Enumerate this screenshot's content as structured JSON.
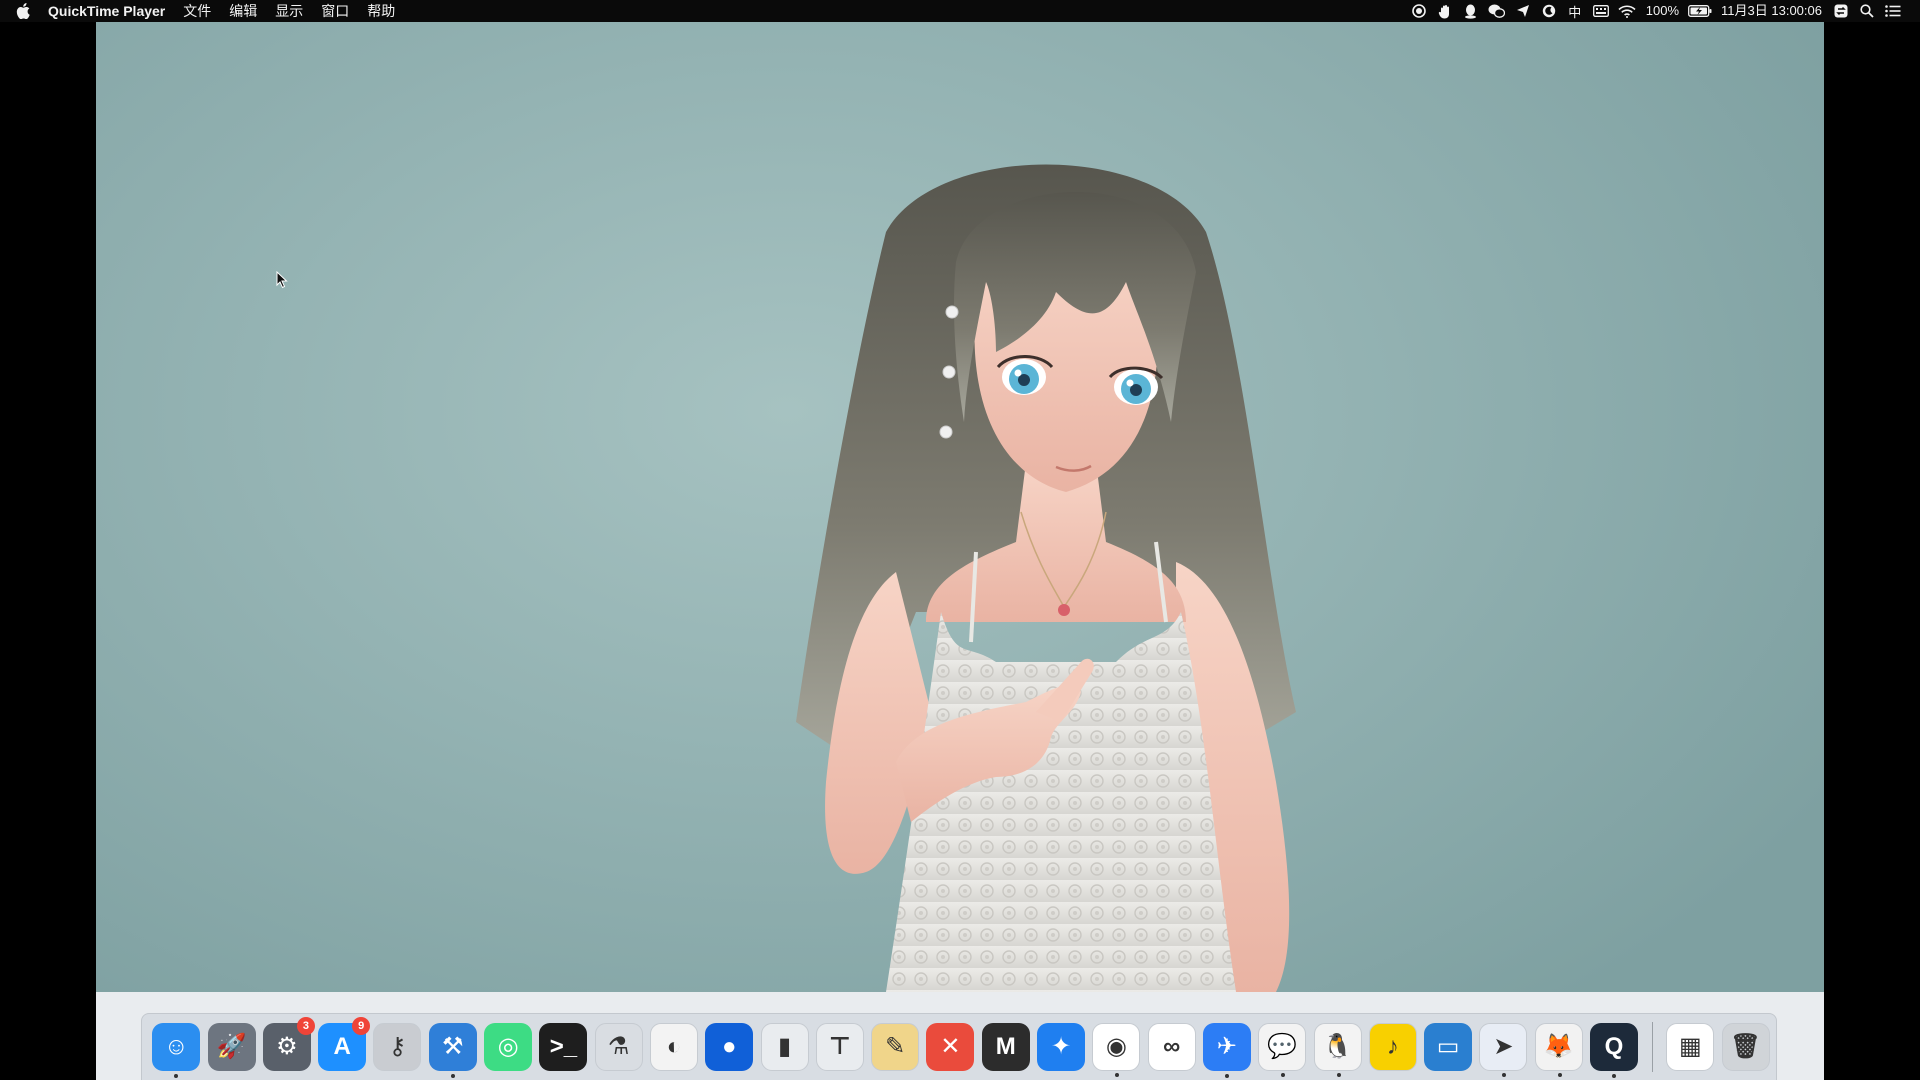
{
  "menubar": {
    "app_name": "QuickTime Player",
    "menus": [
      "文件",
      "编辑",
      "显示",
      "窗口",
      "帮助"
    ],
    "tray": {
      "ime_label": "中",
      "battery": "100%",
      "datetime": "11月3日 13:00:06"
    }
  },
  "dock": {
    "apps": [
      {
        "name": "finder",
        "color": "#2b8ef0",
        "glyph": "☺",
        "running": true
      },
      {
        "name": "launchpad",
        "color": "#6d7580",
        "glyph": "🚀",
        "running": false
      },
      {
        "name": "system-preferences",
        "color": "#59606a",
        "glyph": "⚙",
        "running": false,
        "badge": "3"
      },
      {
        "name": "app-store",
        "color": "#1e90ff",
        "glyph": "A",
        "running": false,
        "badge": "9"
      },
      {
        "name": "keychain-access",
        "color": "#c9ccd1",
        "glyph": "⚷",
        "running": false
      },
      {
        "name": "xcode",
        "color": "#2f7fd8",
        "glyph": "⚒",
        "running": true
      },
      {
        "name": "android-studio",
        "color": "#3ddc84",
        "glyph": "◎",
        "running": false
      },
      {
        "name": "terminal",
        "color": "#1e1e1e",
        "glyph": ">_",
        "running": false
      },
      {
        "name": "cocoapods",
        "color": "#d9dde2",
        "glyph": "⚗",
        "running": false
      },
      {
        "name": "hbuilder",
        "color": "#f3f3f3",
        "glyph": "◐",
        "running": false
      },
      {
        "name": "sourcetree",
        "color": "#1060d8",
        "glyph": "●",
        "running": false
      },
      {
        "name": "numbers",
        "color": "#e9ecef",
        "glyph": "▮",
        "running": false
      },
      {
        "name": "keynote",
        "color": "#e9ecef",
        "glyph": "⊤",
        "running": false
      },
      {
        "name": "pages",
        "color": "#f0d58a",
        "glyph": "✎",
        "running": false
      },
      {
        "name": "xmind",
        "color": "#ea4b3c",
        "glyph": "✕",
        "running": false
      },
      {
        "name": "console",
        "color": "#2c2c2c",
        "glyph": "M",
        "running": false
      },
      {
        "name": "safari",
        "color": "#1f7ff0",
        "glyph": "✦",
        "running": false
      },
      {
        "name": "chrome",
        "color": "#ffffff",
        "glyph": "◉",
        "running": true
      },
      {
        "name": "baidu-netdisk",
        "color": "#ffffff",
        "glyph": "∞",
        "running": false
      },
      {
        "name": "feishu",
        "color": "#2c7df5",
        "glyph": "✈",
        "running": true
      },
      {
        "name": "wechat",
        "color": "#f3f3f3",
        "glyph": "💬",
        "running": true
      },
      {
        "name": "qq",
        "color": "#f3f3f3",
        "glyph": "🐧",
        "running": true
      },
      {
        "name": "qq-music",
        "color": "#f8d000",
        "glyph": "♪",
        "running": false
      },
      {
        "name": "simulator",
        "color": "#2a7fd0",
        "glyph": "▭",
        "running": false
      },
      {
        "name": "swift-playgrounds",
        "color": "#e8edf5",
        "glyph": "➤",
        "running": true
      },
      {
        "name": "firefox",
        "color": "#f2f2f2",
        "glyph": "🦊",
        "running": true
      },
      {
        "name": "quicktime-player",
        "color": "#1d2a3a",
        "glyph": "Q",
        "running": true
      }
    ],
    "extras": [
      {
        "name": "qr-code",
        "color": "#ffffff",
        "glyph": "▦"
      },
      {
        "name": "trash",
        "color": "#d0d4d8",
        "glyph": "🗑"
      }
    ]
  }
}
